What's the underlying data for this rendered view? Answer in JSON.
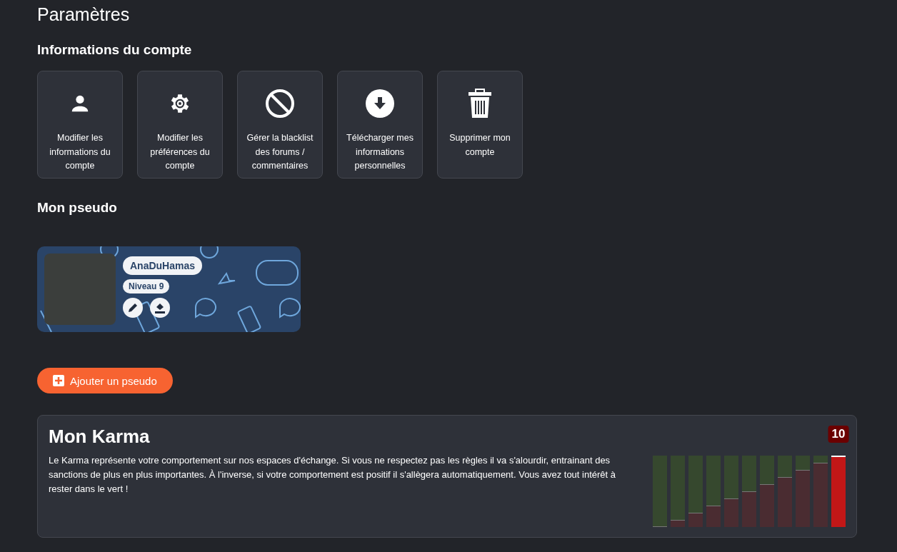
{
  "page_title": "Paramètres",
  "account": {
    "heading": "Informations du compte",
    "actions": [
      {
        "kind": "user",
        "label": "Modifier les informations du compte"
      },
      {
        "kind": "gear",
        "label": "Modifier les préférences du compte"
      },
      {
        "kind": "block",
        "label": "Gérer la blacklist des forums / commentaires"
      },
      {
        "kind": "download",
        "label": "Télécharger mes informations personnelles"
      },
      {
        "kind": "trash",
        "label": "Supprimer mon compte"
      }
    ]
  },
  "pseudo": {
    "heading": "Mon pseudo",
    "name": "AnaDuHamas",
    "level": "Niveau 9"
  },
  "add_button": "Ajouter un pseudo",
  "karma": {
    "title": "Mon Karma",
    "description": "Le Karma représente votre comportement sur nos espaces d'échange. Si vous ne respectez pas les règles il va s'alourdir, entrainant des sanctions de plus en plus importantes. À l'inverse, si votre comportement est positif il s'allègera automatiquement. Vous avez tout intérêt à rester dans le vert !",
    "current": "10",
    "bars": [
      {
        "level": 0,
        "selected": false
      },
      {
        "level": 0.1,
        "selected": false
      },
      {
        "level": 0.2,
        "selected": false
      },
      {
        "level": 0.3,
        "selected": false
      },
      {
        "level": 0.4,
        "selected": false
      },
      {
        "level": 0.5,
        "selected": false
      },
      {
        "level": 0.6,
        "selected": false
      },
      {
        "level": 0.7,
        "selected": false
      },
      {
        "level": 0.8,
        "selected": false
      },
      {
        "level": 0.9,
        "selected": false
      },
      {
        "level": 1,
        "selected": true
      }
    ]
  }
}
